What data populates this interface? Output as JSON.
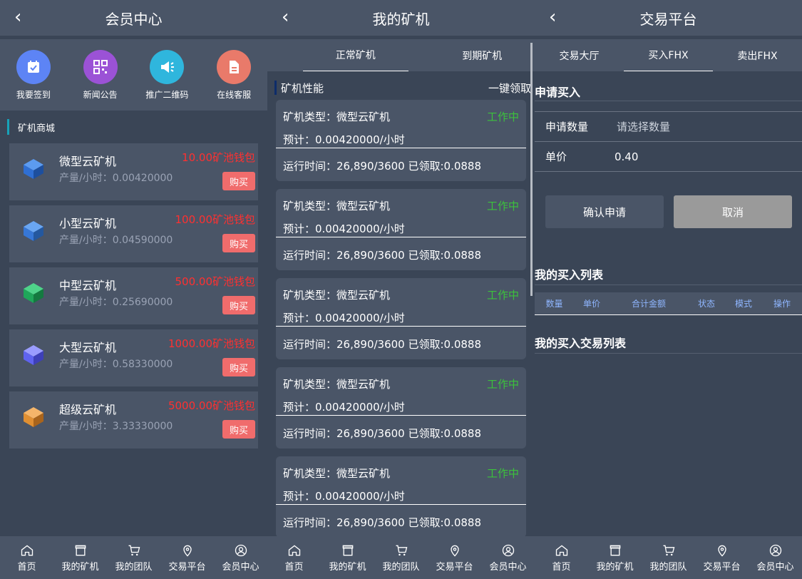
{
  "member": {
    "title": "会员中心",
    "quick": [
      {
        "label": "我要签到",
        "icon": "calendar-check-icon",
        "color": "#5d84f5"
      },
      {
        "label": "新闻公告",
        "icon": "qr-code-icon",
        "color": "#9b52d6"
      },
      {
        "label": "推广二维码",
        "icon": "megaphone-icon",
        "color": "#2fb6dd"
      },
      {
        "label": "在线客服",
        "icon": "document-icon",
        "color": "#e97a6a"
      }
    ],
    "section_title": "矿机商城",
    "buy_label": "购买",
    "mines": [
      {
        "name": "微型云矿机",
        "output": "产量/小时：0.00420000",
        "price": "10.00矿池钱包",
        "color": "#2f6fd3"
      },
      {
        "name": "小型云矿机",
        "output": "产量/小时：0.04590000",
        "price": "100.00矿池钱包",
        "color": "#3777d6"
      },
      {
        "name": "中型云矿机",
        "output": "产量/小时：0.25690000",
        "price": "500.00矿池钱包",
        "color": "#1fa65a"
      },
      {
        "name": "大型云矿机",
        "output": "产量/小时：0.58330000",
        "price": "1000.00矿池钱包",
        "color": "#5f63f0"
      },
      {
        "name": "超级云矿机",
        "output": "产量/小时：3.33330000",
        "price": "5000.00矿池钱包",
        "color": "#e08f32"
      }
    ]
  },
  "miners": {
    "title": "我的矿机",
    "tabs": [
      "正常矿机",
      "到期矿机"
    ],
    "perf_title": "矿机性能",
    "collect_all": "一键领取",
    "cards": [
      {
        "type": "矿机类型：微型云矿机",
        "status": "工作中",
        "estimate": "预计：0.00420000/小时",
        "run": "运行时间：26,890/3600  已领取:0.0888"
      },
      {
        "type": "矿机类型：微型云矿机",
        "status": "工作中",
        "estimate": "预计：0.00420000/小时",
        "run": "运行时间：26,890/3600  已领取:0.0888"
      },
      {
        "type": "矿机类型：微型云矿机",
        "status": "工作中",
        "estimate": "预计：0.00420000/小时",
        "run": "运行时间：26,890/3600  已领取:0.0888"
      },
      {
        "type": "矿机类型：微型云矿机",
        "status": "工作中",
        "estimate": "预计：0.00420000/小时",
        "run": "运行时间：26,890/3600  已领取:0.0888"
      },
      {
        "type": "矿机类型：微型云矿机",
        "status": "工作中",
        "estimate": "预计：0.00420000/小时",
        "run": "运行时间：26,890/3600  已领取:0.0888"
      }
    ]
  },
  "trade": {
    "title": "交易平台",
    "tabs": [
      "交易大厅",
      "买入FHX",
      "卖出FHX"
    ],
    "apply_title": "申请买入",
    "qty_label": "申请数量",
    "qty_placeholder": "请选择数量",
    "price_label": "单价",
    "price_value": "0.40",
    "confirm": "确认申请",
    "cancel": "取消",
    "list_title": "我的买入列表",
    "columns": [
      "数量",
      "单价",
      "合计金额",
      "状态",
      "模式",
      "操作"
    ],
    "trade_list_title": "我的买入交易列表"
  },
  "tabbar": [
    {
      "label": "首页",
      "icon": "home-icon"
    },
    {
      "label": "我的矿机",
      "icon": "store-icon"
    },
    {
      "label": "我的团队",
      "icon": "cart-icon"
    },
    {
      "label": "交易平台",
      "icon": "location-pin-icon"
    },
    {
      "label": "会员中心",
      "icon": "user-icon"
    }
  ]
}
